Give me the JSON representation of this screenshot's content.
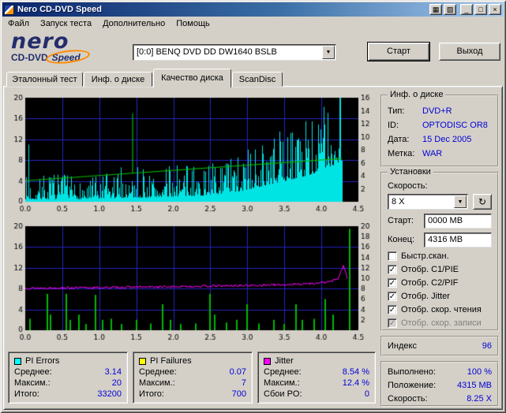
{
  "window": {
    "title": "Nero CD-DVD Speed",
    "controls": {
      "extra1": "▦",
      "extra2": "▨",
      "minimize": "_",
      "maximize": "□",
      "close": "×"
    }
  },
  "icons": {
    "chevron_down": "▼",
    "refresh": "↻"
  },
  "menu": {
    "items": [
      {
        "label": "Файл"
      },
      {
        "label": "Запуск теста"
      },
      {
        "label": "Дополнительно"
      },
      {
        "label": "Помощь"
      }
    ]
  },
  "header": {
    "logo": {
      "brand": "nero",
      "product_line1": "CD-DVD",
      "product_line2": "Speed"
    },
    "drive_select": {
      "value": "[0:0]  BENQ DVD DD DW1640 BSLB"
    },
    "start_button": "Старт",
    "exit_button": "Выход"
  },
  "tabs": [
    {
      "label": "Эталонный тест",
      "active": false
    },
    {
      "label": "Инф. о диске",
      "active": false
    },
    {
      "label": "Качество диска",
      "active": true
    },
    {
      "label": "ScanDisc",
      "active": false
    }
  ],
  "disc_info": {
    "title": "Инф. о диске",
    "rows": [
      {
        "label": "Тип:",
        "value": "DVD+R"
      },
      {
        "label": "ID:",
        "value": "OPTODISC OR8"
      },
      {
        "label": "Дата:",
        "value": "15 Dec 2005"
      },
      {
        "label": "Метка:",
        "value": "WAR"
      }
    ]
  },
  "settings": {
    "title": "Установки",
    "speed_label": "Скорость:",
    "speed_value": "8 X",
    "start_label": "Старт:",
    "start_value": "0000 MB",
    "end_label": "Конец:",
    "end_value": "4316 MB",
    "checkboxes": [
      {
        "label": "Быстр.скан.",
        "checked": false,
        "mark": "",
        "disabled": false
      },
      {
        "label": "Отобр. C1/PIE",
        "checked": true,
        "mark": "✓",
        "disabled": false
      },
      {
        "label": "Отобр. C2/PIF",
        "checked": true,
        "mark": "✓",
        "disabled": false
      },
      {
        "label": "Отобр. Jitter",
        "checked": true,
        "mark": "✓",
        "disabled": false
      },
      {
        "label": "Отобр. скор. чтения",
        "checked": true,
        "mark": "✓",
        "disabled": false
      },
      {
        "label": "Отобр. скор. записи",
        "checked": true,
        "mark": "✓",
        "disabled": true
      }
    ]
  },
  "index_box": {
    "label": "Индекс",
    "value": "96"
  },
  "progress_box": {
    "rows": [
      {
        "label": "Выполнено:",
        "value": "100 %"
      },
      {
        "label": "Положение:",
        "value": "4315 MB"
      },
      {
        "label": "Скорость:",
        "value": "8.25 X"
      }
    ]
  },
  "stats": [
    {
      "title": "PI Errors",
      "swatch": "#00ffff",
      "rows": [
        {
          "label": "Среднее:",
          "value": "3.14"
        },
        {
          "label": "Максим.:",
          "value": "20"
        },
        {
          "label": "Итого:",
          "value": "33200"
        }
      ]
    },
    {
      "title": "PI Failures",
      "swatch": "#ffff00",
      "rows": [
        {
          "label": "Среднее:",
          "value": "0.07"
        },
        {
          "label": "Максим.:",
          "value": "7"
        },
        {
          "label": "Итого:",
          "value": "700"
        }
      ]
    },
    {
      "title": "Jitter",
      "swatch": "#ff00ff",
      "rows": [
        {
          "label": "Среднее:",
          "value": "8.54 %"
        },
        {
          "label": "Максим.:",
          "value": "12.4 %"
        },
        {
          "label": "Сбои PO:",
          "value": "0"
        }
      ]
    }
  ],
  "colors": {
    "chrome": "#d4d0c8",
    "titlebar_start": "#0a246a",
    "titlebar_end": "#a6caf0",
    "value_text": "#0000d8",
    "chart_background": "#000000",
    "chart_grid": "#2626c0",
    "pi_errors_bars": "#00e4e4",
    "pi_failures_bars": "#00b800",
    "jitter_line": "#ff00ff",
    "speed_line": "#00b800"
  },
  "chart_data": [
    {
      "id": "pi_errors_and_read_speed",
      "type": "bar",
      "series": "C1/PIE errors (cyan bars) + reading speed (green line)",
      "x_range": [
        0,
        4.5
      ],
      "x_ticks": [
        0,
        0.5,
        1,
        1.5,
        2,
        2.5,
        3,
        3.5,
        4,
        4.5
      ],
      "y_left": {
        "max": 20,
        "ticks": [
          0,
          4,
          8,
          12,
          16,
          20
        ]
      },
      "y_right": {
        "max": 16,
        "ticks": [
          2,
          4,
          6,
          8,
          10,
          12,
          14,
          16
        ]
      },
      "grid_color": "#2626c0",
      "bar_color": "#00e4e4",
      "data_end_x": 4.28,
      "bar_envelope": [
        [
          0,
          0.5,
          5
        ],
        [
          0.3,
          0.5,
          6
        ],
        [
          0.6,
          0.5,
          5
        ],
        [
          1,
          0.6,
          5
        ],
        [
          1.4,
          0.8,
          8
        ],
        [
          1.6,
          0.8,
          6
        ],
        [
          2,
          1,
          7
        ],
        [
          2.4,
          1.2,
          7
        ],
        [
          2.6,
          1.5,
          8
        ],
        [
          2.9,
          2,
          10
        ],
        [
          3.2,
          3,
          12
        ],
        [
          3.5,
          4,
          14
        ],
        [
          3.8,
          5,
          16
        ],
        [
          4,
          6,
          18
        ],
        [
          4.15,
          7,
          20
        ],
        [
          4.28,
          8,
          20
        ]
      ],
      "extra_spikes": [
        [
          0.04,
          11
        ],
        [
          2.05,
          7
        ],
        [
          4.24,
          20
        ],
        [
          4.25,
          20
        ],
        [
          4.26,
          18
        ]
      ],
      "speed_line": {
        "color": "#00b800",
        "axis": "left",
        "points": [
          [
            0,
            4.05
          ],
          [
            4.28,
            8.3
          ]
        ],
        "glitch": {
          "x": 1.45,
          "top": 17
        }
      },
      "stats": {
        "average": 3.14,
        "maximum": 20,
        "total": 33200
      },
      "seed": 7
    },
    {
      "id": "pi_failures_and_jitter",
      "type": "bar",
      "series": "C2/PIF failures (green bars) + jitter (magenta line)",
      "x_range": [
        0,
        4.5
      ],
      "x_ticks": [
        0,
        0.5,
        1,
        1.5,
        2,
        2.5,
        3,
        3.5,
        4,
        4.5
      ],
      "y_left": {
        "max": 20,
        "ticks": [
          0,
          4,
          8,
          12,
          16,
          20
        ]
      },
      "y_right": {
        "max": 20,
        "ticks": [
          2,
          4,
          6,
          8,
          10,
          12,
          14,
          16,
          18,
          20
        ]
      },
      "grid_color": "#2626c0",
      "bar_color": "#00b800",
      "green_bars": [
        [
          0.06,
          2.2
        ],
        [
          0.3,
          7
        ],
        [
          0.34,
          3
        ],
        [
          0.55,
          7
        ],
        [
          0.61,
          2
        ],
        [
          0.73,
          3
        ],
        [
          0.82,
          1.2
        ],
        [
          0.95,
          6.8
        ],
        [
          1.05,
          2
        ],
        [
          1.16,
          2.2
        ],
        [
          1.3,
          1.2
        ],
        [
          1.5,
          2
        ],
        [
          1.7,
          1.3
        ],
        [
          1.86,
          5
        ],
        [
          1.96,
          2
        ],
        [
          2.1,
          1.2
        ],
        [
          2.3,
          1.3
        ],
        [
          2.5,
          7
        ],
        [
          2.56,
          3
        ],
        [
          2.72,
          1.5
        ],
        [
          2.86,
          2
        ],
        [
          3,
          5
        ],
        [
          3.16,
          1.3
        ],
        [
          3.36,
          2
        ],
        [
          3.5,
          1.2
        ],
        [
          3.66,
          5
        ],
        [
          3.74,
          2
        ],
        [
          3.9,
          2.2
        ],
        [
          4.05,
          6
        ],
        [
          4.16,
          3
        ],
        [
          4.38,
          19.5
        ]
      ],
      "jitter_line": {
        "color": "#ff00ff",
        "noise": 0.22,
        "end_x": 4.36,
        "points": [
          [
            0,
            8.1
          ],
          [
            0.5,
            8.15
          ],
          [
            1,
            8.2
          ],
          [
            1.5,
            8.3
          ],
          [
            2,
            8.35
          ],
          [
            2.5,
            8.5
          ],
          [
            3,
            8.6
          ],
          [
            3.5,
            8.75
          ],
          [
            3.9,
            9
          ],
          [
            4.1,
            9.3
          ],
          [
            4.22,
            9.8
          ],
          [
            4.3,
            12.4
          ],
          [
            4.36,
            9.5
          ]
        ]
      },
      "stats": {
        "average_pct": 8.54,
        "maximum_pct": 12.4,
        "po_failures": 0
      },
      "seed": 13
    }
  ]
}
